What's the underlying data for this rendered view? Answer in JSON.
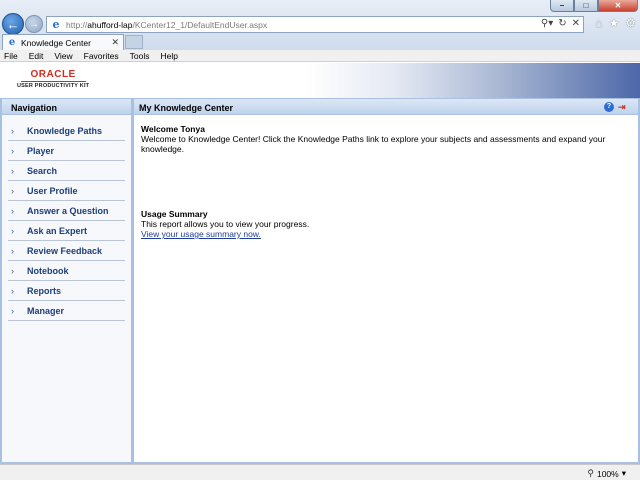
{
  "browser": {
    "url_prefix": "http://",
    "url_host": "ahufford-lap",
    "url_path": "/KCenter12_1/DefaultEndUser.aspx",
    "tab_title": "Knowledge Center",
    "menu": [
      "File",
      "Edit",
      "View",
      "Favorites",
      "Tools",
      "Help"
    ],
    "zoom_level": "100%"
  },
  "header": {
    "logo_brand": "ORACLE",
    "logo_product": "USER PRODUCTIVITY KIT"
  },
  "navigation": {
    "title": "Navigation",
    "items": [
      "Knowledge Paths",
      "Player",
      "Search",
      "User Profile",
      "Answer a Question",
      "Ask an Expert",
      "Review Feedback",
      "Notebook",
      "Reports",
      "Manager"
    ]
  },
  "main": {
    "title": "My Knowledge Center",
    "welcome_heading": "Welcome Tonya",
    "welcome_text": "Welcome to Knowledge Center! Click the Knowledge Paths link to explore your subjects and assessments and expand your knowledge.",
    "usage_heading": "Usage Summary",
    "usage_text": "This report allows you to view your progress.",
    "usage_link": "View your usage summary now."
  },
  "colors": {
    "nav_text": "#1c3e78",
    "panel_border": "#a8c0e2",
    "oracle_red": "#d52b1e",
    "link": "#1e3c9a"
  },
  "icons": {
    "back": "back-arrow-icon",
    "forward": "forward-arrow-icon",
    "browser": "ie-icon",
    "home": "home-icon",
    "favorites": "star-icon",
    "settings": "gear-icon",
    "help": "help-icon",
    "exit": "exit-icon",
    "zoom": "zoom-icon"
  }
}
